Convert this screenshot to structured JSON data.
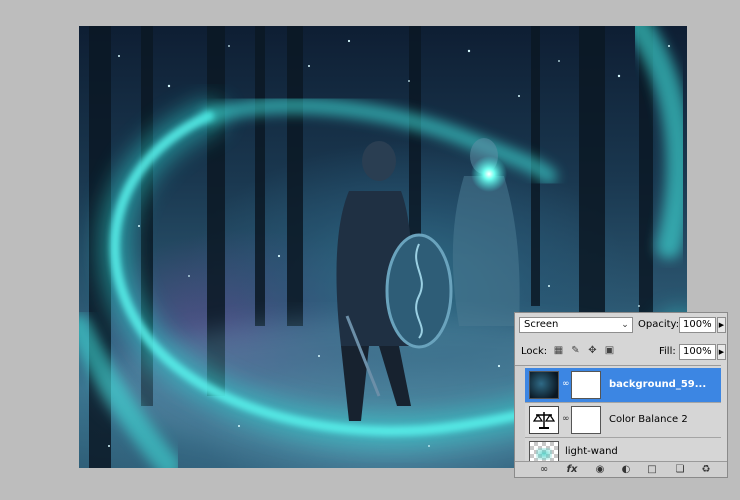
{
  "layers_panel": {
    "blend_mode": "Screen",
    "opacity_label": "Opacity:",
    "opacity_value": "100%",
    "lock_label": "Lock:",
    "fill_label": "Fill:",
    "fill_value": "100%",
    "layers": [
      {
        "name": "background_59...",
        "selected": true
      },
      {
        "name": "Color Balance 2",
        "selected": false
      },
      {
        "name": "light-wand",
        "selected": false
      }
    ]
  },
  "icons": {
    "lock_transparent": "checkerboard-icon",
    "lock_pixels": "brush-icon",
    "lock_position": "move-icon",
    "lock_all": "padlock-icon",
    "bottom_tools": [
      "link-icon",
      "fx-icon",
      "mask-icon",
      "adjustment-icon",
      "folder-icon",
      "new-layer-icon",
      "trash-icon"
    ]
  },
  "colors": {
    "selection": "#3c86e3",
    "panel_bg": "#d6d6d6",
    "glow": "#3fe6e0"
  }
}
